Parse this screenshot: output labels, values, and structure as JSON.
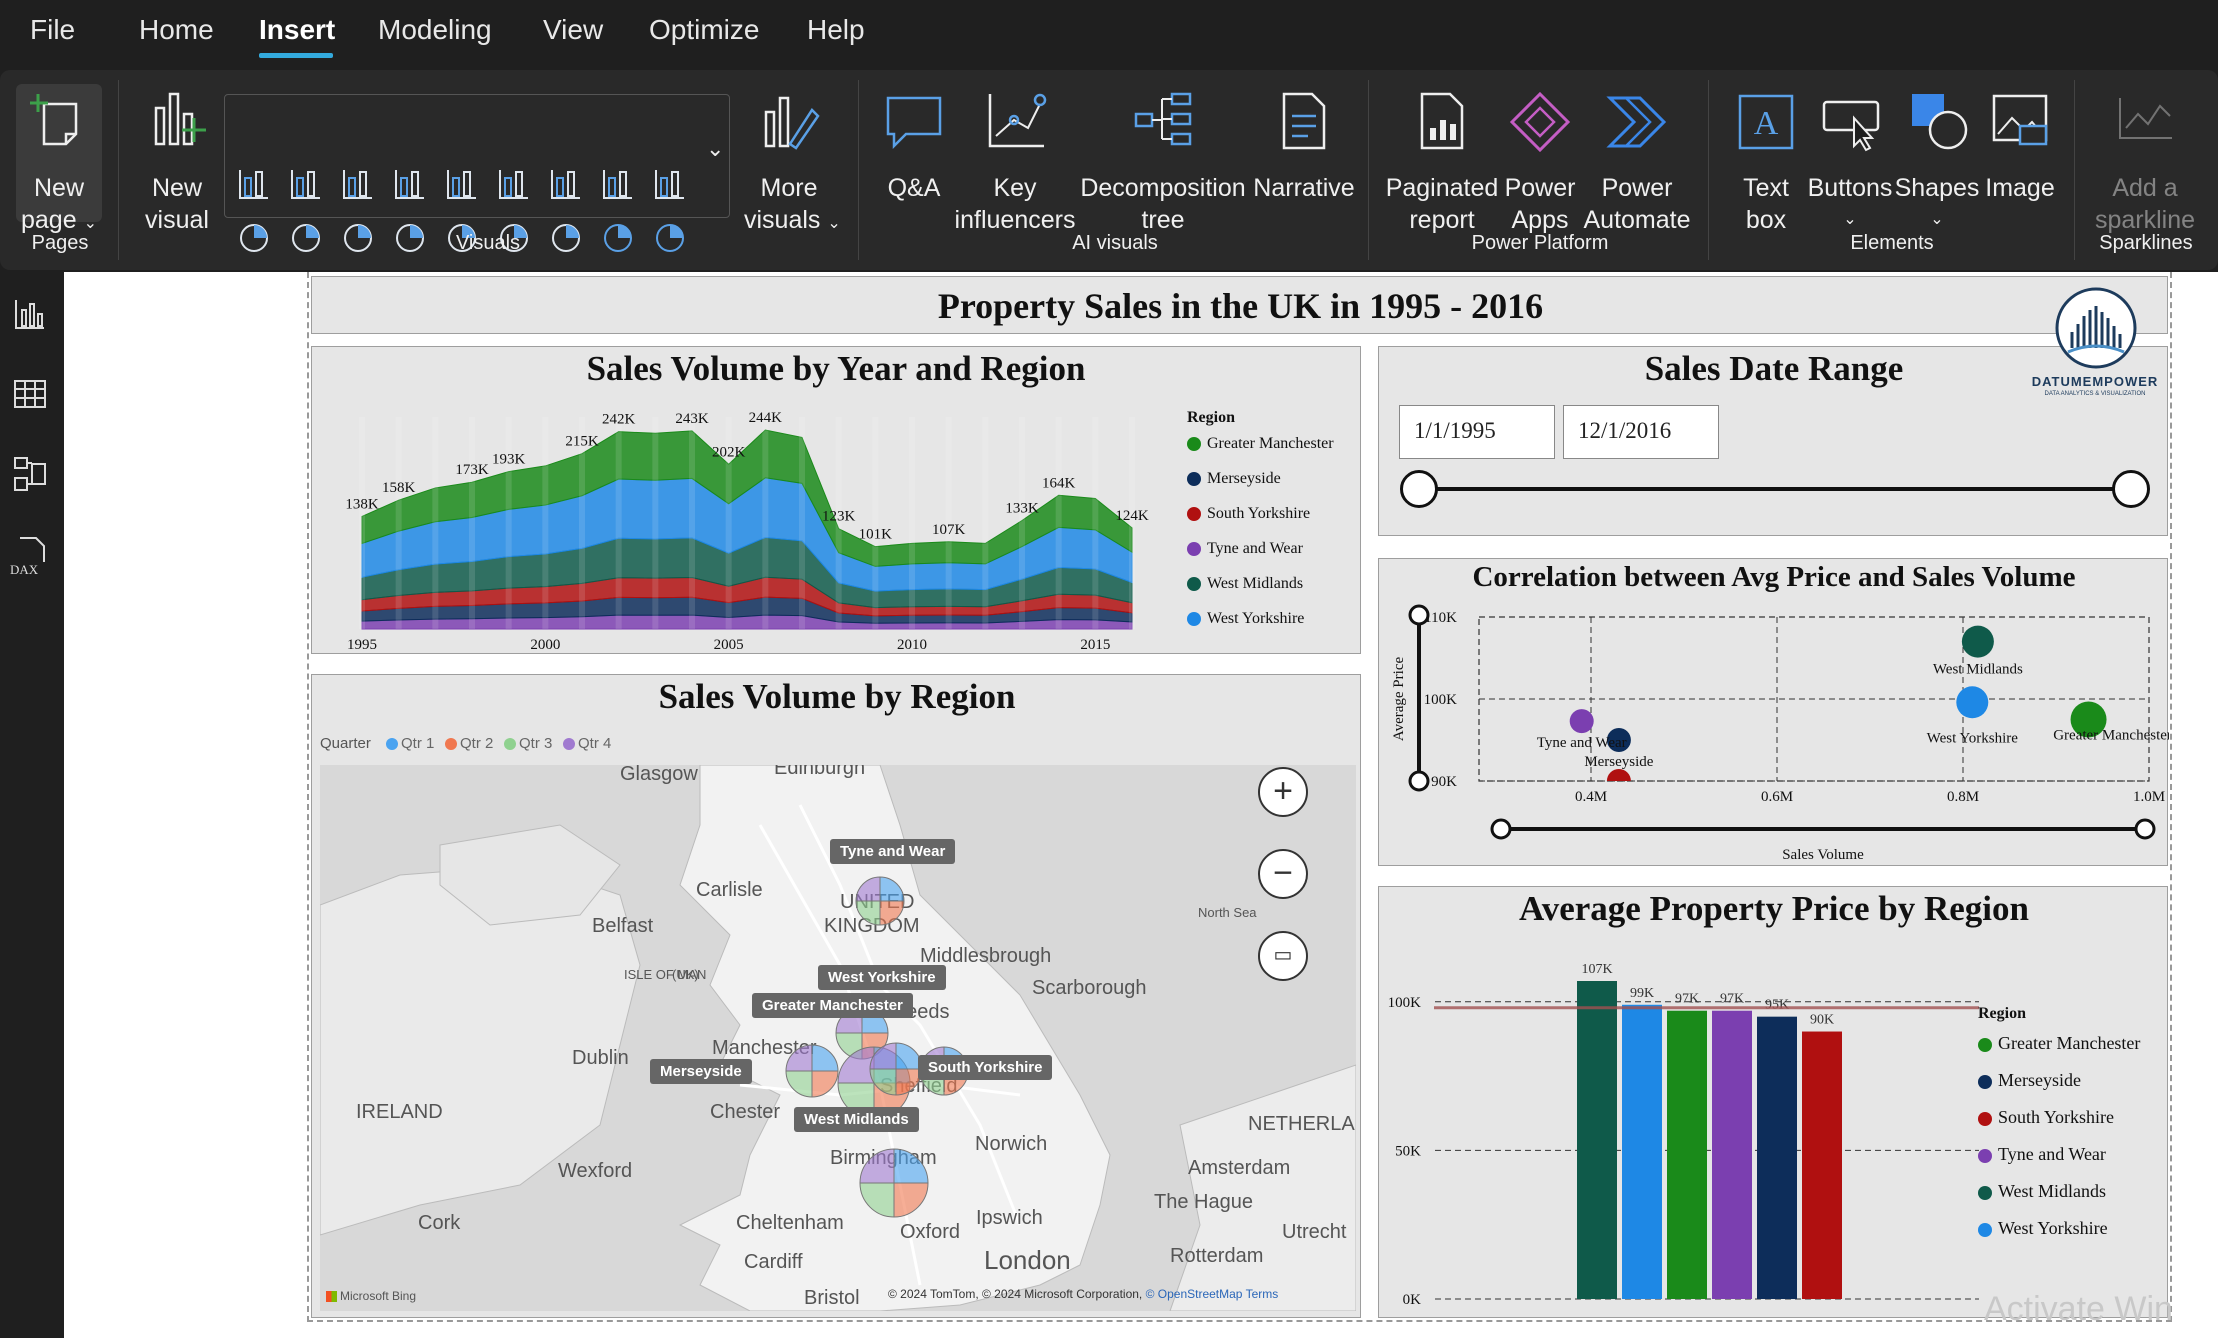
{
  "menu": {
    "items": [
      "File",
      "Home",
      "Insert",
      "Modeling",
      "View",
      "Optimize",
      "Help"
    ],
    "active": "Insert"
  },
  "ribbon": {
    "pages": {
      "new_page_l1": "New",
      "new_page_l2": "page",
      "group": "Pages"
    },
    "visuals": {
      "new_visual_l1": "New",
      "new_visual_l2": "visual",
      "more_l1": "More",
      "more_l2": "visuals",
      "group": "Visuals"
    },
    "ai": {
      "qa": "Q&A",
      "key_l1": "Key",
      "key_l2": "influencers",
      "decomp_l1": "Decomposition",
      "decomp_l2": "tree",
      "narrative": "Narrative",
      "group": "AI visuals"
    },
    "power": {
      "paginated_l1": "Paginated",
      "paginated_l2": "report",
      "apps_l1": "Power",
      "apps_l2": "Apps",
      "automate_l1": "Power",
      "automate_l2": "Automate",
      "group": "Power Platform"
    },
    "elements": {
      "text_l1": "Text",
      "text_l2": "box",
      "buttons": "Buttons",
      "shapes": "Shapes",
      "image": "Image",
      "group": "Elements"
    },
    "sparklines": {
      "l1": "Add a",
      "l2": "sparkline",
      "group": "Sparklines"
    }
  },
  "report": {
    "title": "Property Sales in the UK in 1995 - 2016",
    "logo": {
      "name": "DATUMEMPOWER",
      "tagline": "DATA ANALYTICS & VISUALIZATION"
    },
    "watermark": "Activate Win"
  },
  "area_chart": {
    "title": "Sales Volume by Year and Region",
    "legend_title": "Region"
  },
  "date_range": {
    "title": "Sales Date Range",
    "start": "1/1/1995",
    "end": "12/1/2016",
    "start_fraction": 0,
    "end_fraction": 1
  },
  "scatter": {
    "title": "Correlation between Avg Price and Sales Volume"
  },
  "map": {
    "title": "Sales Volume by Region",
    "legend_title": "Quarter",
    "quarters": [
      {
        "name": "Qtr 1",
        "color": "#4aa3f0"
      },
      {
        "name": "Qtr 2",
        "color": "#f07850"
      },
      {
        "name": "Qtr 3",
        "color": "#8fd18f"
      },
      {
        "name": "Qtr 4",
        "color": "#a07ad0"
      }
    ],
    "region_labels": [
      "Tyne and Wear",
      "West Yorkshire",
      "Greater Manchester",
      "Merseyside",
      "South Yorkshire",
      "West Midlands"
    ],
    "cities": [
      "Glasgow",
      "Edinburgh",
      "Carlisle",
      "Belfast",
      "ISLE OF MAN",
      "(UK)",
      "Middlesbrough",
      "Scarborough",
      "Leeds",
      "Dublin",
      "Manchester",
      "Sheffield",
      "Chester",
      "IRELAND",
      "Wexford",
      "Cork",
      "Birmingham",
      "Norwich",
      "Amsterdam",
      "The Hague",
      "NETHERLAN",
      "Ipswich",
      "Cheltenham",
      "Oxford",
      "London",
      "Rotterdam",
      "Utrecht",
      "Cardiff",
      "Bristol",
      "North Sea",
      "UNITED",
      "KINGDOM"
    ],
    "attribution": "© 2024 TomTom, © 2024 Microsoft Corporation,",
    "osm": "© OpenStreetMap",
    "terms": "Terms",
    "brand": "Microsoft Bing"
  },
  "bar_chart": {
    "title": "Average Property Price by Region",
    "legend_title": "Region"
  },
  "chart_data": [
    {
      "type": "area",
      "title": "Sales Volume by Year and Region",
      "stacked": true,
      "x_ticks": [
        "1995",
        "2000",
        "2005",
        "2010",
        "2015"
      ],
      "x": [
        1995,
        1996,
        1997,
        1998,
        1999,
        2000,
        2001,
        2002,
        2003,
        2004,
        2005,
        2006,
        2007,
        2008,
        2009,
        2010,
        2011,
        2012,
        2013,
        2014,
        2015,
        2016
      ],
      "totals": [
        138,
        158,
        173,
        180,
        193,
        200,
        215,
        242,
        240,
        243,
        202,
        244,
        235,
        123,
        101,
        105,
        107,
        105,
        133,
        164,
        160,
        124
      ],
      "data_labels": [
        {
          "x": 1995,
          "label": "138K"
        },
        {
          "x": 1996,
          "label": "158K"
        },
        {
          "x": 1998,
          "label": "173K"
        },
        {
          "x": 1999,
          "label": "193K"
        },
        {
          "x": 2001,
          "label": "215K"
        },
        {
          "x": 2002,
          "label": "242K"
        },
        {
          "x": 2004,
          "label": "243K"
        },
        {
          "x": 2005,
          "label": "202K"
        },
        {
          "x": 2006,
          "label": "244K"
        },
        {
          "x": 2008,
          "label": "123K"
        },
        {
          "x": 2009,
          "label": "101K"
        },
        {
          "x": 2011,
          "label": "107K"
        },
        {
          "x": 2013,
          "label": "133K"
        },
        {
          "x": 2014,
          "label": "164K"
        },
        {
          "x": 2016,
          "label": "124K"
        }
      ],
      "series": [
        {
          "name": "Tyne and Wear",
          "color": "#7b3fb0",
          "share": 0.07
        },
        {
          "name": "Merseyside",
          "color": "#0d2d5a",
          "share": 0.09
        },
        {
          "name": "South Yorkshire",
          "color": "#b01010",
          "share": 0.1
        },
        {
          "name": "West Midlands",
          "color": "#0f5a4a",
          "share": 0.2
        },
        {
          "name": "West Yorkshire",
          "color": "#1e88e5",
          "share": 0.3
        },
        {
          "name": "Greater Manchester",
          "color": "#1a8a1a",
          "share": 0.24
        }
      ],
      "legend": [
        "Greater Manchester",
        "Merseyside",
        "South Yorkshire",
        "Tyne and Wear",
        "West Midlands",
        "West Yorkshire"
      ],
      "legend_colors": [
        "#1a8a1a",
        "#0d2d5a",
        "#b01010",
        "#7b3fb0",
        "#0f5a4a",
        "#1e88e5"
      ],
      "ylim": [
        0,
        260
      ]
    },
    {
      "type": "scatter",
      "title": "Correlation between Avg Price and Sales Volume",
      "xlabel": "Sales Volume",
      "ylabel": "Average Price",
      "x_ticks": [
        "0.4M",
        "0.6M",
        "0.8M",
        "1.0M"
      ],
      "y_ticks": [
        "110K",
        "100K",
        "90K"
      ],
      "xlim": [
        0.4,
        1.0
      ],
      "ylim": [
        90,
        110
      ],
      "points": [
        {
          "name": "West Midlands",
          "x": 0.816,
          "y": 107,
          "color": "#0f5a4a",
          "label": "West Midlands"
        },
        {
          "name": "West Yorkshire",
          "x": 0.81,
          "y": 99.6,
          "color": "#1e88e5",
          "label": "West Yorkshire"
        },
        {
          "name": "Greater Manchester",
          "x": 0.935,
          "y": 97.5,
          "color": "#1a8a1a",
          "label": "Greater Manchester"
        },
        {
          "name": "Tyne and Wear",
          "x": 0.39,
          "y": 97.3,
          "color": "#7b3fb0",
          "label": "Tyne and Wear"
        },
        {
          "name": "Merseyside",
          "x": 0.43,
          "y": 95,
          "color": "#0d2d5a",
          "label": "Merseyside"
        },
        {
          "name": "South Yorkshire",
          "x": 0.43,
          "y": 90,
          "color": "#b01010",
          "label": ""
        }
      ]
    },
    {
      "type": "bar",
      "title": "Average Property Price by Region",
      "categories": [
        "West Midlands",
        "West Yorkshire",
        "Greater Manchester",
        "Tyne and Wear",
        "Merseyside",
        "South Yorkshire"
      ],
      "values": [
        107,
        99,
        97,
        97,
        95,
        90
      ],
      "labels": [
        "107K",
        "99K",
        "97K",
        "97K",
        "95K",
        "90K"
      ],
      "colors": [
        "#0f5a4a",
        "#1e88e5",
        "#1a8a1a",
        "#7b3fb0",
        "#0d2d5a",
        "#b01010"
      ],
      "y_ticks": [
        "100K",
        "50K",
        "0K"
      ],
      "ylim": [
        0,
        107
      ],
      "reference_line": 98,
      "legend": [
        "Greater Manchester",
        "Merseyside",
        "South Yorkshire",
        "Tyne and Wear",
        "West Midlands",
        "West Yorkshire"
      ],
      "legend_colors": [
        "#1a8a1a",
        "#0d2d5a",
        "#b01010",
        "#7b3fb0",
        "#0f5a4a",
        "#1e88e5"
      ]
    }
  ]
}
